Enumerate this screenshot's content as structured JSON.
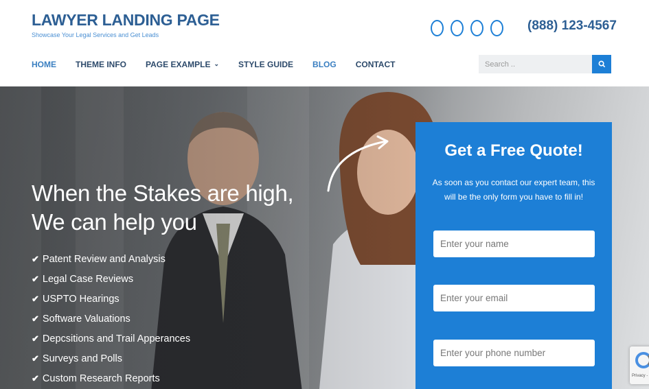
{
  "site": {
    "title": "LAWYER LANDING PAGE",
    "tagline": "Showcase Your Legal Services and Get Leads",
    "phone": "(888) 123-4567"
  },
  "social_icons": [
    "circle-icon",
    "circle-icon",
    "circle-icon",
    "circle-icon"
  ],
  "nav": {
    "items": [
      {
        "label": "HOME",
        "active": true
      },
      {
        "label": "THEME INFO"
      },
      {
        "label": "PAGE EXAMPLE",
        "has_dropdown": true
      },
      {
        "label": "STYLE GUIDE"
      },
      {
        "label": "BLOG"
      },
      {
        "label": "CONTACT"
      }
    ]
  },
  "search": {
    "placeholder": "Search .."
  },
  "hero": {
    "headline_line1": "When the Stakes are high,",
    "headline_line2": "We can help you",
    "features": [
      "Patent Review and Analysis",
      "Legal Case Reviews",
      "USPTO Hearings",
      "Software Valuations",
      "Depcsitions and Trail Apperances",
      "Surveys and Polls",
      "Custom Research Reports"
    ]
  },
  "quote_form": {
    "title": "Get a Free Quote!",
    "description": "As soon as you contact our expert team, this will be the only form you have to fill in!",
    "name_placeholder": "Enter your name",
    "email_placeholder": "Enter your email",
    "phone_placeholder": "Enter your phone number"
  },
  "recaptcha": {
    "label": "Privacy -"
  },
  "colors": {
    "accent": "#1d7fd6",
    "title": "#2d5f94"
  }
}
